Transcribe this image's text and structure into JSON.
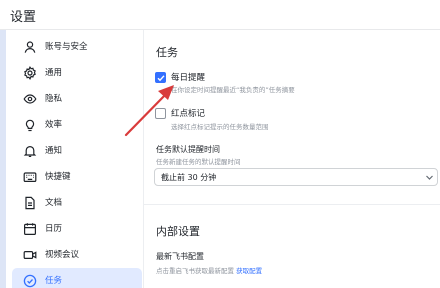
{
  "header": {
    "title": "设置"
  },
  "sidebar": {
    "items": [
      {
        "label": "账号与安全",
        "icon": "user-icon"
      },
      {
        "label": "通用",
        "icon": "gear-icon"
      },
      {
        "label": "隐私",
        "icon": "eye-icon"
      },
      {
        "label": "效率",
        "icon": "lightbulb-icon"
      },
      {
        "label": "通知",
        "icon": "bell-icon"
      },
      {
        "label": "快捷键",
        "icon": "keyboard-icon"
      },
      {
        "label": "文档",
        "icon": "doc-icon"
      },
      {
        "label": "日历",
        "icon": "calendar-icon"
      },
      {
        "label": "视频会议",
        "icon": "video-icon"
      },
      {
        "label": "任务",
        "icon": "task-icon"
      }
    ],
    "active_index": 9
  },
  "tasks": {
    "section_title": "任务",
    "daily_reminder": {
      "label": "每日提醒",
      "desc": "在你设定时间提醒最近“我负责的”任务摘要",
      "checked": true
    },
    "red_dot": {
      "label": "红点标记",
      "desc": "选择红点标记提示的任务数量范围",
      "checked": false
    },
    "default_reminder": {
      "label": "任务默认提醒时间",
      "desc": "任务新建任务的默认提醒时间",
      "value": "截止前 30 分钟"
    }
  },
  "internal": {
    "section_title": "内部设置",
    "label": "最新飞书配置",
    "desc": "点击重启飞书获取最新配置",
    "link": "获取配置"
  },
  "colors": {
    "accent": "#3370ff",
    "arrow": "#d93b3b",
    "active_bg": "#e1eaff"
  }
}
